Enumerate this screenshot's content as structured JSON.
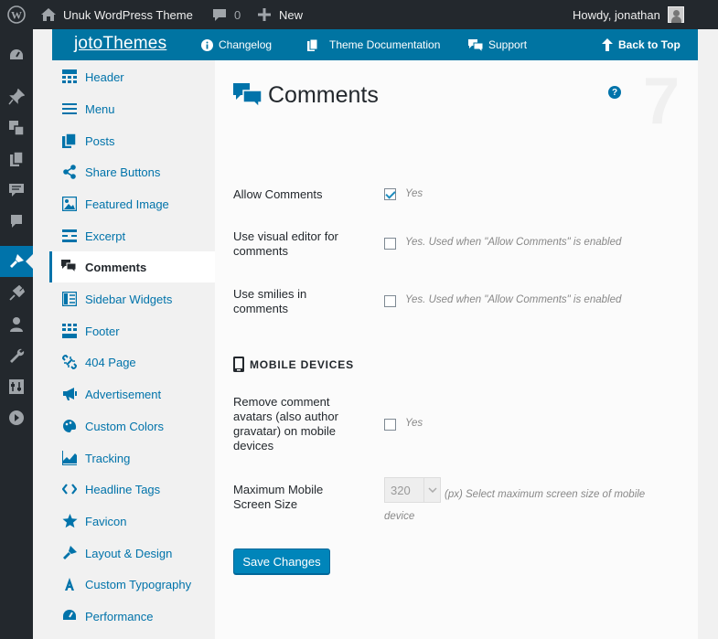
{
  "adminbar": {
    "site_name": "Unuk WordPress Theme",
    "comments_count": "0",
    "new_label": "New",
    "greeting": "Howdy, jonathan"
  },
  "adminmenu": {
    "icons": [
      "dashboard-icon",
      "pin-icon",
      "media-icon",
      "pages-icon",
      "comments-icon",
      "feedback-icon",
      "appearance-icon",
      "plugins-icon",
      "users-icon",
      "tools-icon",
      "settings-icon",
      "collapse-icon"
    ]
  },
  "topbar": {
    "logo": "jotoThemes",
    "changelog": "Changelog",
    "docs": "Theme Documentation",
    "support": "Support",
    "back_to_top": "Back to Top"
  },
  "nav": {
    "items": [
      {
        "label": "Header",
        "icon": "header-icon"
      },
      {
        "label": "Menu",
        "icon": "menu-icon"
      },
      {
        "label": "Posts",
        "icon": "posts-icon"
      },
      {
        "label": "Share Buttons",
        "icon": "share-icon"
      },
      {
        "label": "Featured Image",
        "icon": "image-icon"
      },
      {
        "label": "Excerpt",
        "icon": "excerpt-icon"
      },
      {
        "label": "Comments",
        "icon": "comments-icon"
      },
      {
        "label": "Sidebar Widgets",
        "icon": "sidebar-icon"
      },
      {
        "label": "Footer",
        "icon": "footer-icon"
      },
      {
        "label": "404 Page",
        "icon": "broken-link-icon"
      },
      {
        "label": "Advertisement",
        "icon": "megaphone-icon"
      },
      {
        "label": "Custom Colors",
        "icon": "palette-icon"
      },
      {
        "label": "Tracking",
        "icon": "chart-icon"
      },
      {
        "label": "Headline Tags",
        "icon": "code-icon"
      },
      {
        "label": "Favicon",
        "icon": "star-icon"
      },
      {
        "label": "Layout & Design",
        "icon": "brush-icon"
      },
      {
        "label": "Custom Typography",
        "icon": "typography-icon"
      },
      {
        "label": "Performance",
        "icon": "dashboard-icon"
      }
    ],
    "active_index": 6
  },
  "content": {
    "title": "Comments",
    "page_number": "7",
    "help_symbol": "?",
    "fields": {
      "allow_comments": {
        "label": "Allow Comments",
        "desc": "Yes",
        "checked": true
      },
      "visual_editor": {
        "label": "Use visual editor for comments",
        "desc": "Yes. Used when \"Allow Comments\" is enabled",
        "checked": false
      },
      "smilies": {
        "label": "Use smilies in comments",
        "desc": "Yes. Used when \"Allow Comments\" is enabled",
        "checked": false
      },
      "remove_avatars": {
        "label": "Remove comment avatars (also author gravatar) on mobile devices",
        "desc": "Yes",
        "checked": false
      },
      "max_mobile": {
        "label": "Maximum Mobile Screen Size",
        "value": "320",
        "desc": "(px) Select maximum screen size of mobile device"
      }
    },
    "section_mobile": "MOBILE DEVICES",
    "save_label": "Save Changes"
  },
  "colors": {
    "accent": "#0074a2",
    "admin_bar": "#23282d",
    "link": "#0073aa"
  }
}
